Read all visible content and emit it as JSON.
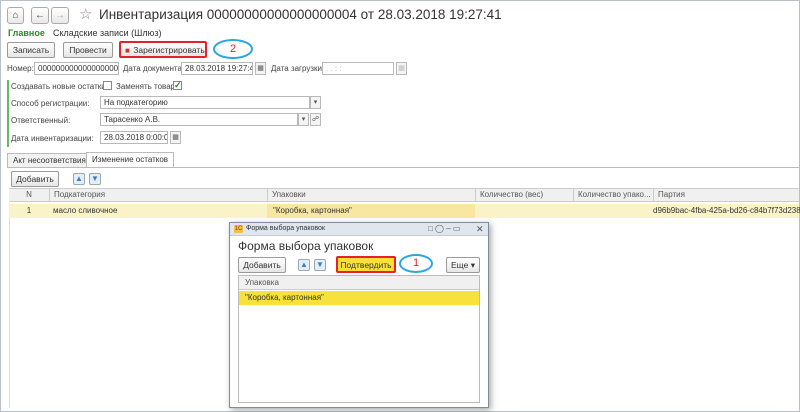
{
  "header": {
    "home_icon": "home-icon",
    "back_icon": "back-arrow-icon",
    "forward_icon": "forward-arrow-icon",
    "star_icon": "star-icon",
    "title": "Инвентаризация 00000000000000000004 от 28.03.2018 19:27:41"
  },
  "nav": {
    "main": "Главное",
    "warehouse": "Складские записи (Шлюз)"
  },
  "toolbar": {
    "save": "Записать",
    "post": "Провести",
    "register": "Зарегистрировать",
    "annotation_2": "2"
  },
  "fields": {
    "number_label": "Номер:",
    "number_value": "00000000000000000004",
    "doc_date_label": "Дата документа:",
    "doc_date_value": "28.03.2018 19:27:41",
    "load_date_label": "Дата загрузки:",
    "load_date_value": ". .    : :",
    "create_new_label": "Создавать новые остатки:",
    "replace_goods_label": "Заменять товар:",
    "reg_method_label": "Способ регистрации:",
    "reg_method_value": "На подкатегорию",
    "responsible_label": "Ответственный:",
    "responsible_value": "Тарасенко А.В.",
    "inv_date_label": "Дата инвентаризации:",
    "inv_date_value": "28.03.2018  0:00:00"
  },
  "tabs": {
    "tab1": "Акт несоответствия",
    "tab2": "Изменение остатков"
  },
  "table": {
    "add_button": "Добавить",
    "columns": [
      "N",
      "Подкатегория",
      "Упаковки",
      "Количество (вес)",
      "Количество упако...",
      "Партия"
    ],
    "rows": [
      {
        "n": "1",
        "subcategory": "масло сливочное",
        "packaging": "\"Коробка, картонная\"",
        "qty_weight": "",
        "qty_packs": "",
        "batch": "d96b9bac-4fba-425a-bd26-c84b7f73d238"
      }
    ]
  },
  "dialog": {
    "window_title": "Форма выбора упаковок",
    "heading": "Форма выбора упаковок",
    "add_button": "Добавить",
    "confirm_button": "Подтвердить",
    "annotation_1": "1",
    "more_button": "Еще",
    "column": "Упаковка",
    "row1": "\"Коробка, картонная\""
  },
  "colors": {
    "highlight_red": "#e8202a",
    "annotation_blue": "#2aa7df",
    "selected_row": "#f7e13a",
    "nav_green": "#2a8a2a"
  }
}
